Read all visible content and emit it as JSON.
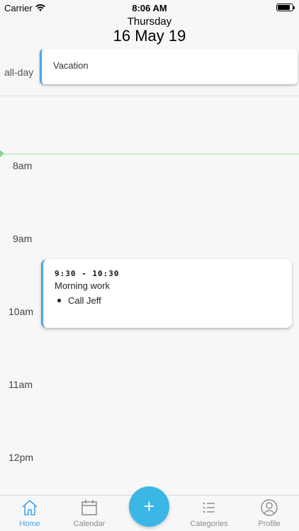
{
  "status_bar": {
    "carrier": "Carrier",
    "time": "8:06 AM"
  },
  "header": {
    "weekday": "Thursday",
    "date": "16 May 19"
  },
  "allday": {
    "label": "all-day",
    "event_title": "Vacation"
  },
  "timeline": {
    "hours": [
      "8am",
      "9am",
      "10am",
      "11am",
      "12pm"
    ],
    "event": {
      "time": "9:30 - 10:30",
      "title": "Morning work",
      "items": [
        "Call Jeff"
      ]
    }
  },
  "tabbar": {
    "home": "Home",
    "calendar": "Calendar",
    "add": "+",
    "categories": "Categories",
    "profile": "Profile"
  },
  "colors": {
    "accent": "#4aa3e8",
    "fab": "#3bb7e6",
    "now_line": "#9be0a6"
  }
}
